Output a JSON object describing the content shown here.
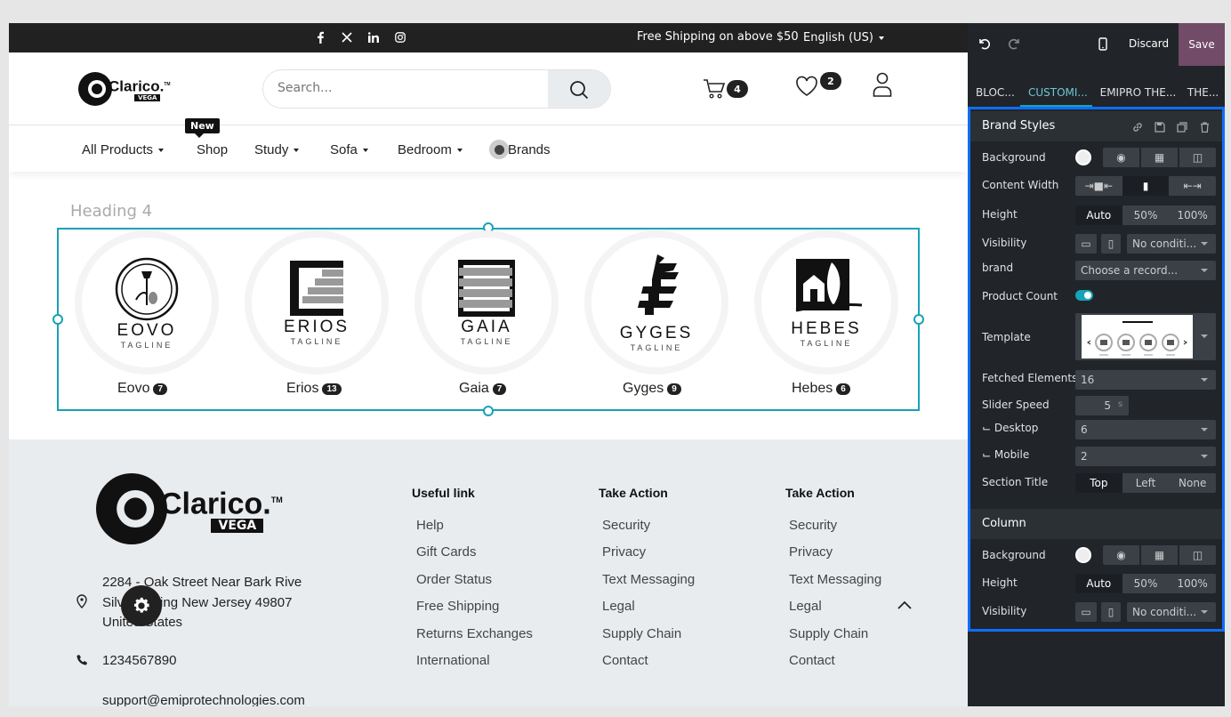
{
  "topbar": {
    "social_icons": [
      "facebook-icon",
      "x-icon",
      "linkedin-icon",
      "instagram-icon"
    ],
    "shipping_text": "Free Shipping on above $50",
    "language": "English (US)"
  },
  "header": {
    "logo_text": "Clarico.",
    "logo_sub": "VEGA",
    "logo_tm": "TM",
    "search_placeholder": "Search...",
    "cart_count": "4",
    "wishlist_count": "2"
  },
  "nav": {
    "new_tag": "New",
    "items": [
      "All Products",
      "Shop",
      "Study",
      "Sofa",
      "Bedroom",
      "Brands"
    ]
  },
  "section": {
    "heading": "Heading 4",
    "brands": [
      {
        "name": "Eovo",
        "count": "7",
        "logo_text": "EOVO",
        "tagline": "TAGLINE"
      },
      {
        "name": "Erios",
        "count": "13",
        "logo_text": "ERIOS",
        "tagline": "TAGLINE"
      },
      {
        "name": "Gaia",
        "count": "7",
        "logo_text": "GAIA",
        "tagline": "TAGLINE"
      },
      {
        "name": "Gyges",
        "count": "9",
        "logo_text": "GYGES",
        "tagline": "TAGLINE"
      },
      {
        "name": "Hebes",
        "count": "6",
        "logo_text": "HEBES",
        "tagline": "TAGLINE"
      }
    ]
  },
  "footer": {
    "address_line1": "2284 - Oak Street Near Bark Rive",
    "address_line2": "Silver Spring New Jersey 49807",
    "address_line3": "United States",
    "phone": "1234567890",
    "email": "support@emiprotechnologies.com",
    "columns": [
      {
        "title": "Useful link",
        "links": [
          "Help",
          "Gift Cards",
          "Order Status",
          "Free Shipping",
          "Returns Exchanges",
          "International"
        ]
      },
      {
        "title": "Take Action",
        "links": [
          "Security",
          "Privacy",
          "Text Messaging",
          "Legal",
          "Supply Chain",
          "Contact"
        ]
      },
      {
        "title": "Take Action",
        "links": [
          "Security",
          "Privacy",
          "Text Messaging",
          "Legal",
          "Supply Chain",
          "Contact"
        ]
      }
    ]
  },
  "panel": {
    "discard": "Discard",
    "save": "Save",
    "tabs": [
      "BLOC...",
      "CUSTOMI...",
      "EMIPRO THE...",
      "THE..."
    ],
    "active_tab": 1,
    "brand_styles": {
      "title": "Brand Styles",
      "background": "Background",
      "content_width": "Content Width",
      "height": "Height",
      "height_options": [
        "Auto",
        "50%",
        "100%"
      ],
      "visibility": "Visibility",
      "visibility_value": "No conditi...",
      "brand": "brand",
      "brand_value": "Choose a record...",
      "product_count": "Product Count",
      "template": "Template",
      "fetched_elements": "Fetched Elements",
      "fetched_value": "16",
      "slider_speed": "Slider Speed",
      "slider_value": "5",
      "slider_unit": "s",
      "desktop": "⌙ Desktop",
      "desktop_value": "6",
      "mobile": "⌙ Mobile",
      "mobile_value": "2",
      "section_title": "Section Title",
      "section_title_options": [
        "Top",
        "Left",
        "None"
      ]
    },
    "column": {
      "title": "Column",
      "background": "Background",
      "height": "Height",
      "height_options": [
        "Auto",
        "50%",
        "100%"
      ],
      "visibility": "Visibility",
      "visibility_value": "No conditi..."
    }
  },
  "colors": {
    "accent": "#17a2b8",
    "save_bg": "#714b67",
    "panel_bg": "#212529",
    "footer_bg": "#e9ecef"
  }
}
